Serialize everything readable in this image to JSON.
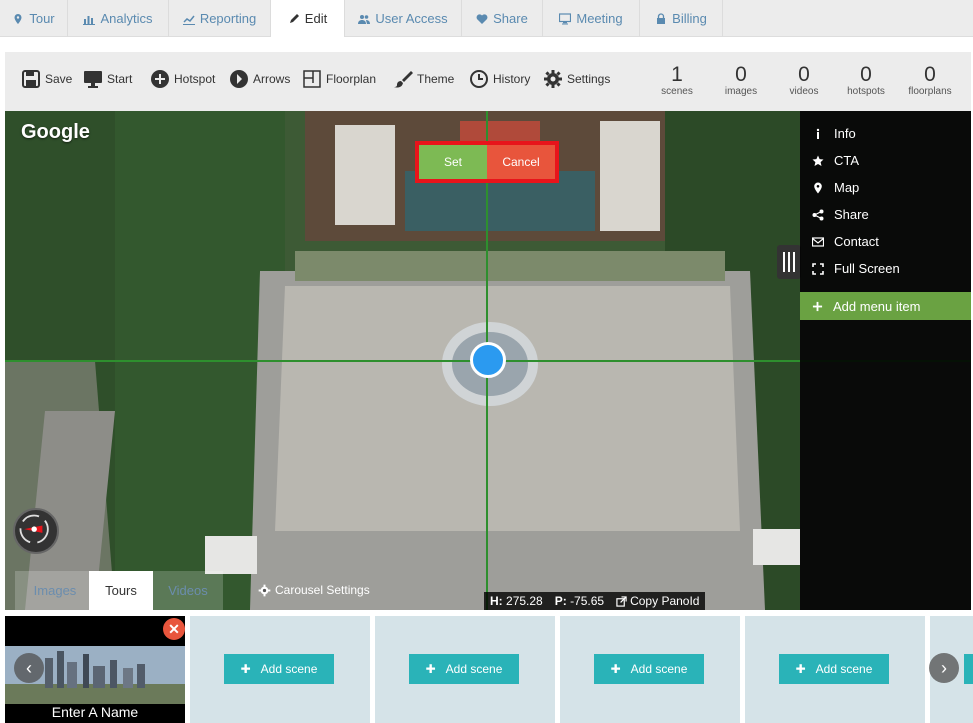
{
  "nav": {
    "tabs": [
      {
        "label": "Tour",
        "icon": "map-marker-icon"
      },
      {
        "label": "Analytics",
        "icon": "bar-chart-icon"
      },
      {
        "label": "Reporting",
        "icon": "line-chart-icon"
      },
      {
        "label": "Edit",
        "icon": "pencil-icon"
      },
      {
        "label": "User Access",
        "icon": "users-icon"
      },
      {
        "label": "Share",
        "icon": "heart-icon"
      },
      {
        "label": "Meeting",
        "icon": "monitor-icon"
      },
      {
        "label": "Billing",
        "icon": "lock-icon"
      }
    ],
    "active": "Edit"
  },
  "toolbar": {
    "save": "Save",
    "start": "Start",
    "hotspot": "Hotspot",
    "arrows": "Arrows",
    "floorplan": "Floorplan",
    "theme": "Theme",
    "history": "History",
    "settings": "Settings"
  },
  "stats": {
    "scenes": {
      "value": "1",
      "label": "scenes"
    },
    "images": {
      "value": "0",
      "label": "images"
    },
    "videos": {
      "value": "0",
      "label": "videos"
    },
    "hotspots": {
      "value": "0",
      "label": "hotspots"
    },
    "floorplans": {
      "value": "0",
      "label": "floorplans"
    }
  },
  "viewer": {
    "google_logo": "Google",
    "set_label": "Set",
    "cancel_label": "Cancel",
    "heading_label": "H:",
    "heading_value": "275.28",
    "pitch_label": "P:",
    "pitch_value": "-75.65",
    "copy_panoid": "Copy PanoId"
  },
  "sidemenu": {
    "items": [
      {
        "label": "Info",
        "icon": "info-icon"
      },
      {
        "label": "CTA",
        "icon": "star-icon"
      },
      {
        "label": "Map",
        "icon": "map-pin-icon"
      },
      {
        "label": "Share",
        "icon": "share-icon"
      },
      {
        "label": "Contact",
        "icon": "envelope-icon"
      },
      {
        "label": "Full Screen",
        "icon": "expand-icon"
      }
    ],
    "add_item": "Add menu item"
  },
  "bottom_tabs": {
    "images": "Images",
    "tours": "Tours",
    "videos": "Videos",
    "active": "Tours",
    "carousel_settings": "Carousel Settings"
  },
  "scenes": {
    "first_name": "Enter A Name",
    "add_label": "Add scene"
  },
  "colors": {
    "accent_green": "#6aa242",
    "teal": "#2ab3b8",
    "cancel_red": "#e8553c",
    "target_blue": "#2b9af0",
    "nav_link": "#5a8ab0"
  }
}
